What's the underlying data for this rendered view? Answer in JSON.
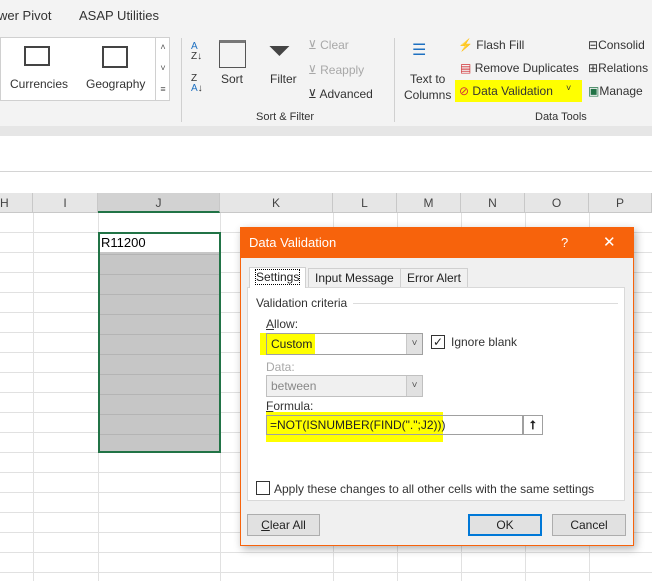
{
  "ribbon_tabs": [
    "wer Pivot",
    "ASAP Utilities"
  ],
  "data_types": {
    "currencies": "Currencies",
    "geography": "Geography"
  },
  "sort_filter": {
    "sort": "Sort",
    "filter": "Filter",
    "clear": "Clear",
    "reapply": "Reapply",
    "advanced": "Advanced",
    "group": "Sort & Filter"
  },
  "data_tools": {
    "text_to_columns_1": "Text to",
    "text_to_columns_2": "Columns",
    "flash_fill": "Flash Fill",
    "remove_duplicates": "Remove Duplicates",
    "data_validation": "Data Validation",
    "consolidate": "Consolid",
    "relationships": "Relations",
    "manage": "Manage",
    "group": "Data Tools"
  },
  "columns": [
    "H",
    "I",
    "J",
    "K",
    "L",
    "M",
    "N",
    "O",
    "P"
  ],
  "cell_j2": "R11200",
  "dialog": {
    "title": "Data Validation",
    "help": "?",
    "close": "✕",
    "tabs": [
      "Settings",
      "Input Message",
      "Error Alert"
    ],
    "section": "Validation criteria",
    "allow_label": "Allow:",
    "allow_value": "Custom",
    "ignore_blank": "Ignore blank",
    "ignore_blank_checked": true,
    "data_label": "Data:",
    "data_value": "between",
    "formula_label": "Formula:",
    "formula_value": "=NOT(ISNUMBER(FIND(\".\";J2)))",
    "apply_all": "Apply these changes to all other cells with the same settings",
    "apply_all_checked": false,
    "clear_all": "Clear All",
    "ok": "OK",
    "cancel": "Cancel"
  },
  "colors": {
    "accent": "#f7630c",
    "highlight": "#ffff00",
    "selection": "#217346"
  }
}
